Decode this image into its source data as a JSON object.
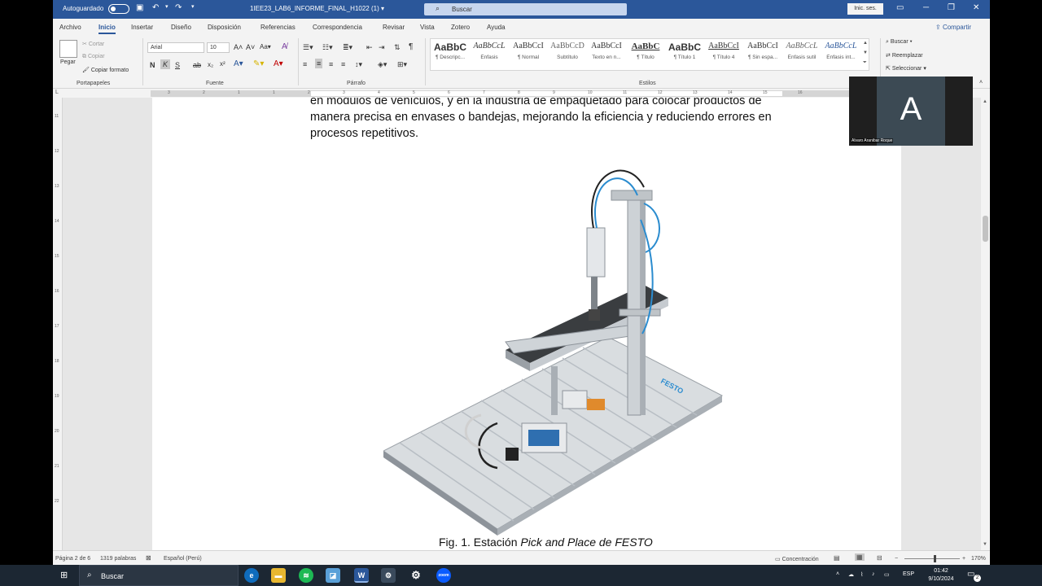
{
  "titlebar": {
    "autosave_label": "Autoguardado",
    "doc_title": "1IEE23_LAB6_INFORME_FINAL_H1022 (1) ▾",
    "search_placeholder": "Buscar",
    "signin_label": "Inic. ses."
  },
  "tabs": [
    "Archivo",
    "Inicio",
    "Insertar",
    "Diseño",
    "Disposición",
    "Referencias",
    "Correspondencia",
    "Revisar",
    "Vista",
    "Zotero",
    "Ayuda"
  ],
  "active_tab": "Inicio",
  "share_label": "Compartir",
  "ribbon": {
    "clipboard": {
      "paste": "Pegar",
      "cut": "Cortar",
      "copy": "Copiar",
      "format_painter": "Copiar formato",
      "label": "Portapapeles"
    },
    "font": {
      "name": "Arial",
      "size": "10",
      "label": "Fuente"
    },
    "paragraph": {
      "label": "Párrafo"
    },
    "styles": {
      "label": "Estilos",
      "items": [
        {
          "preview": "AaBbC",
          "name": "¶ Descripc..."
        },
        {
          "preview": "AaBbCcL",
          "name": "Énfasis"
        },
        {
          "preview": "AaBbCcI",
          "name": "¶ Normal"
        },
        {
          "preview": "AaBbCcD",
          "name": "Subtítulo"
        },
        {
          "preview": "AaBbCcI",
          "name": "Texto en n..."
        },
        {
          "preview": "AaBbC",
          "name": "¶ Título"
        },
        {
          "preview": "AaBbC",
          "name": "¶ Título 1"
        },
        {
          "preview": "AaBbCcI",
          "name": "¶ Título 4"
        },
        {
          "preview": "AaBbCcI",
          "name": "¶ Sin espa..."
        },
        {
          "preview": "AaBbCcL",
          "name": "Énfasis sutil"
        },
        {
          "preview": "AaBbCcL",
          "name": "Énfasis int..."
        }
      ]
    },
    "editing": {
      "find": "Buscar",
      "replace": "Reemplazar",
      "select": "Seleccionar"
    }
  },
  "document": {
    "lines": [
      "en módulos de vehículos, y en la industria de empaquetado para colocar productos de",
      "manera precisa en envases o bandejas, mejorando la eficiencia y reduciendo errores en",
      "procesos repetitivos."
    ],
    "caption_prefix": "Fig. 1. Estación ",
    "caption_italic": "Pick and Place de FESTO"
  },
  "overlay": {
    "letter": "A",
    "name": "Alvaro Aranibar Roque"
  },
  "statusbar": {
    "page": "Página 2 de 6",
    "words": "1319 palabras",
    "language": "Español (Perú)",
    "focus": "Concentración",
    "zoom": "170%"
  },
  "taskbar": {
    "search": "Buscar",
    "lang": "ESP",
    "time": "01:42",
    "date": "9/10/2024",
    "notif_count": "2"
  }
}
